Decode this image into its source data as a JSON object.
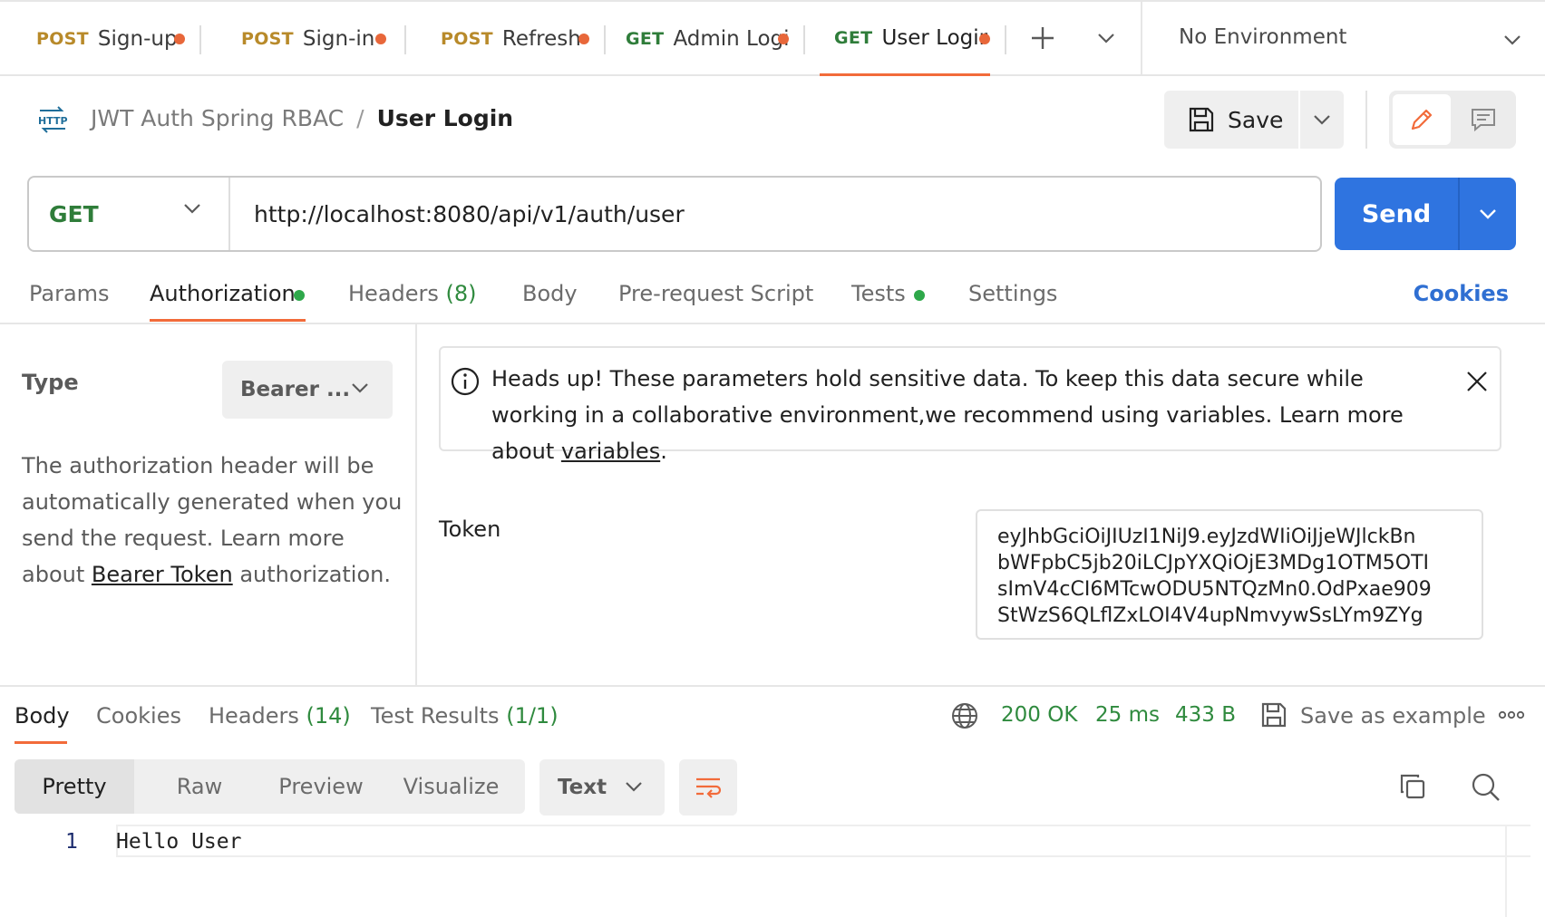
{
  "tabs": [
    {
      "method": "POST",
      "name": "Sign-up"
    },
    {
      "method": "POST",
      "name": "Sign-in"
    },
    {
      "method": "POST",
      "name": "Refresh"
    },
    {
      "method": "GET",
      "name": "Admin Logi"
    },
    {
      "method": "GET",
      "name": "User Logir"
    }
  ],
  "environment": {
    "label": "No Environment"
  },
  "breadcrumb": {
    "icon_text": "HTTP",
    "collection": "JWT Auth Spring RBAC",
    "separator": "/",
    "request": "User Login"
  },
  "toolbar": {
    "save_label": "Save"
  },
  "request": {
    "method": "GET",
    "url": "http://localhost:8080/api/v1/auth/user",
    "send_label": "Send"
  },
  "request_tabs": {
    "params": "Params",
    "authorization": "Authorization",
    "headers": "Headers",
    "headers_count": "(8)",
    "body": "Body",
    "prerequest": "Pre-request Script",
    "tests": "Tests",
    "settings": "Settings",
    "cookies": "Cookies"
  },
  "auth": {
    "type_label": "Type",
    "type_value": "Bearer ...",
    "desc_before": "The authorization header will be automatically generated when you send the request. Learn more about ",
    "desc_link": "Bearer Token",
    "desc_after": " authorization.",
    "alert_text": "Heads up! These parameters hold sensitive data. To keep this data secure while working in a collaborative environment,we recommend using variables. Learn more about ",
    "alert_link": "variables",
    "alert_end": ".",
    "token_label": "Token",
    "token_lines": [
      "eyJhbGciOiJIUzI1NiJ9.eyJzdWIiOiJjeWJlckBn",
      "bWFpbC5jb20iLCJpYXQiOjE3MDg1OTM5OTI",
      "sImV4cCI6MTcwODU5NTQzMn0.OdPxae909",
      "StWzS6QLflZxLOI4V4upNmvywSsLYm9ZYg"
    ]
  },
  "response": {
    "tabs": {
      "body": "Body",
      "cookies": "Cookies",
      "headers": "Headers",
      "headers_count": "(14)",
      "tests": "Test Results",
      "tests_count": "(1/1)"
    },
    "status": "200 OK",
    "time": "25 ms",
    "size": "433 B",
    "save_example": "Save as example",
    "views": [
      "Pretty",
      "Raw",
      "Preview",
      "Visualize"
    ],
    "format": "Text",
    "line_number": "1",
    "body_text": "Hello User"
  },
  "colors": {
    "accent": "#f26b3a",
    "send": "#2f74e0",
    "get": "#2f7d3a",
    "post": "#b88a2a",
    "ok": "#2f8a3e",
    "link": "#2f6fd2"
  }
}
